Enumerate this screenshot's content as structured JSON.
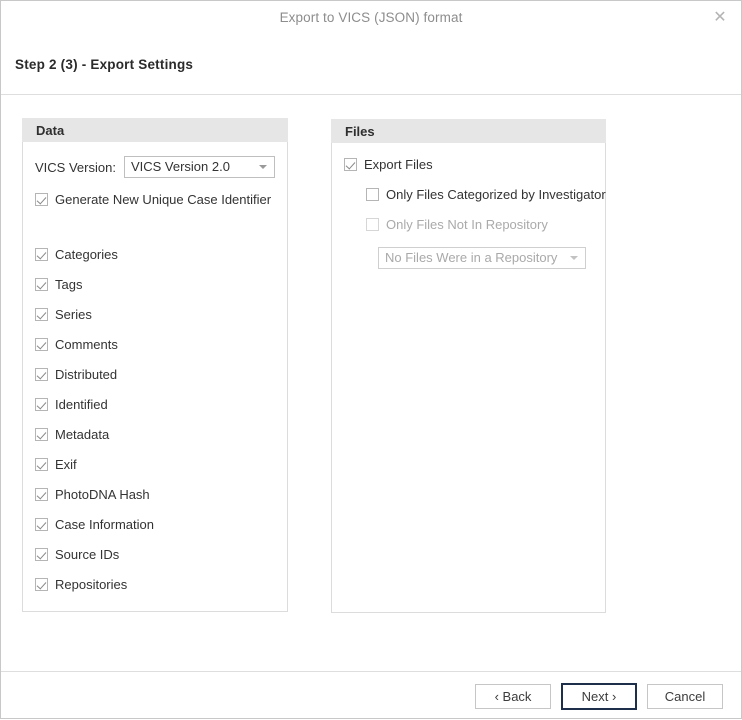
{
  "window": {
    "title": "Export to VICS (JSON) format",
    "close_icon": "close-icon",
    "step_title": "Step 2 (3) - Export Settings"
  },
  "data_panel": {
    "header": "Data",
    "version_label": "VICS Version:",
    "version_value": "VICS Version 2.0",
    "options": [
      {
        "label": "Generate New Unique Case Identifier",
        "checked": true,
        "gap_after": true
      },
      {
        "label": "Categories",
        "checked": true
      },
      {
        "label": "Tags",
        "checked": true
      },
      {
        "label": "Series",
        "checked": true
      },
      {
        "label": "Comments",
        "checked": true
      },
      {
        "label": "Distributed",
        "checked": true
      },
      {
        "label": "Identified",
        "checked": true
      },
      {
        "label": "Metadata",
        "checked": true
      },
      {
        "label": "Exif",
        "checked": true
      },
      {
        "label": "PhotoDNA Hash",
        "checked": true
      },
      {
        "label": "Case Information",
        "checked": true
      },
      {
        "label": "Source IDs",
        "checked": true
      },
      {
        "label": "Repositories",
        "checked": true
      }
    ]
  },
  "files_panel": {
    "header": "Files",
    "export_files": {
      "label": "Export Files",
      "checked": true
    },
    "only_categorized": {
      "label": "Only Files Categorized by Investigator",
      "checked": false
    },
    "only_not_in_repo": {
      "label": "Only Files Not In Repository",
      "checked": false,
      "disabled": true
    },
    "repository_value": "No Files Were in a Repository"
  },
  "footer": {
    "back_label": "‹ Back",
    "next_label": "Next ›",
    "cancel_label": "Cancel"
  },
  "colors": {
    "panel_header_bg": "#e6e6e6",
    "default_button_border": "#1d2f4a",
    "divider": "#dedede"
  }
}
